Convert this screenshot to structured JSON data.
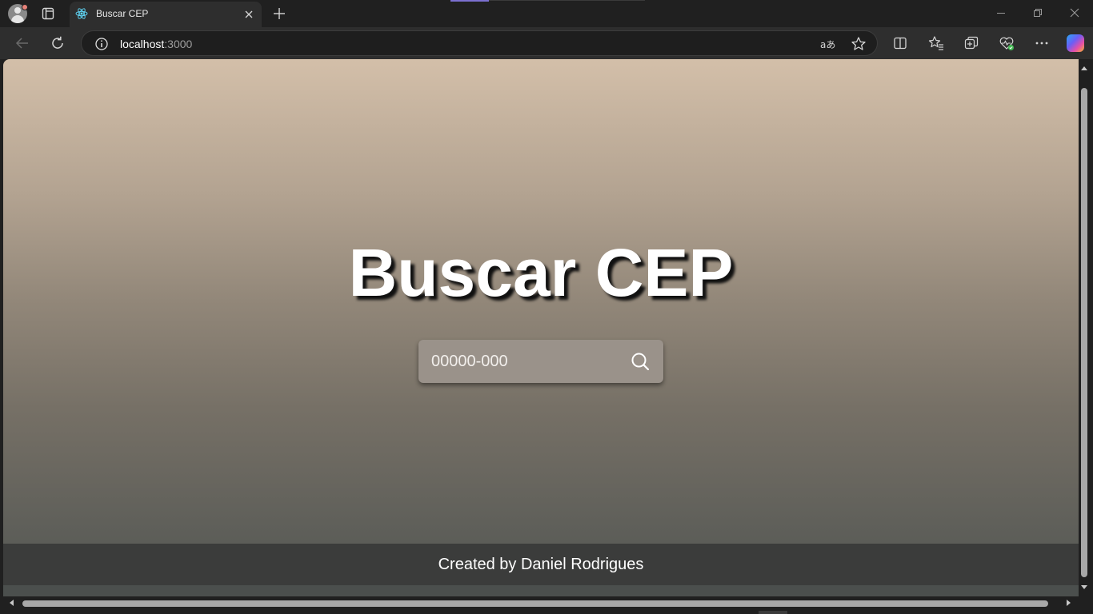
{
  "browser": {
    "tab": {
      "title": "Buscar CEP",
      "favicon": "react-icon"
    },
    "address": {
      "host": "localhost",
      "port": ":3000"
    },
    "colors": {
      "accent": "#7b6fd0",
      "chrome": "#202020",
      "toolbar": "#2e2e2e"
    }
  },
  "page": {
    "headline": "Buscar CEP",
    "search": {
      "placeholder": "00000-000",
      "value": "",
      "button_icon": "search-icon"
    },
    "footer": "Created by Daniel Rodrigues",
    "colors": {
      "gradient_top": "#d3bfa9",
      "gradient_bottom": "#575a56",
      "footer_bg": "#3b3c3b"
    }
  }
}
